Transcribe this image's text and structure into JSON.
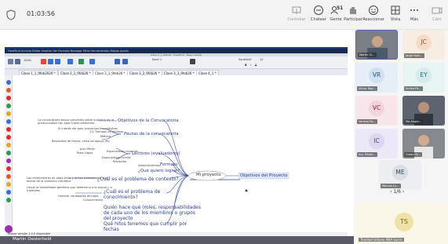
{
  "meeting": {
    "timer": "01:03:56"
  },
  "toolbar": {
    "items": [
      {
        "label": "Controlar",
        "icon": "control-icon"
      },
      {
        "label": "Chatear",
        "icon": "chat-icon"
      },
      {
        "label": "Gente",
        "icon": "people-icon",
        "badge": "51"
      },
      {
        "label": "Participar",
        "icon": "raise-hand-icon"
      },
      {
        "label": "Reaccionar",
        "icon": "react-icon"
      },
      {
        "label": "Vista",
        "icon": "view-icon"
      },
      {
        "label": "Más",
        "icon": "more-icon"
      },
      {
        "label": "Cám",
        "icon": "camera-icon"
      }
    ]
  },
  "shared_app": {
    "title_bar": "Clase 3_1_9feb26 · FreeMind · Mapa mental",
    "menu_text": "FreeMind  Archivo  Editar  Insertar  Ver  Formato  Navegar  Filtro  Herramientas  Mapas  Ayuda",
    "font_name": "SansSerif",
    "font_size": "12",
    "zoom": "100%",
    "node_style": "Nivel 1",
    "tabs": [
      "Clase 1_1_9feb2026 *",
      "Clase 2_1_9feb26 *",
      "Clase 3_1_9feb26 *",
      "Clase 3_2_9feb26 *",
      "Clase 3_3_9feb26 *",
      "Clase 4_1 *"
    ],
    "status": "Nueva versión 1.0.0 disponible"
  },
  "mindmap": {
    "root": "Mi proyecto",
    "right_node": "Objetivos del Proyecto",
    "branches": [
      "Objetivos de la Convocatoria",
      "Pautas de la convocatoria",
      "Lectores (evaluadores)",
      "Formato",
      "¿Qué quiero lograr?",
      "¿Cuál es el problema de contexto?",
      "¿Cuál es el problema de conocimiento?",
      "Quién hace qué (roles, responsabilidades de cada uno de los miembros o grupos del proyecto",
      "Qué hitos tenemos que cumplir por fechas"
    ],
    "small_notes": [
      "La convocatoria busca proyectos sobre sustento de la",
      "productividad con bajo huella ambiental",
      "El interés del país: proyectos tecnológicos",
      "1:1 Tiempos de entrega",
      "Métrica",
      "Requisitos de firmas, carta de apoyo, etc",
      "Juan Pérez",
      "Rosa López",
      "Especialistas expertos",
      "Especialistas comité",
      "Revisores",
      "Administrativos",
      "Los rendimientos de papa en la y la han demostrado que",
      "efecto de la variación climática",
      "Llevar la variabilidad genética que determina a la arquía y a",
      "tuberales",
      "Generar variedades de papa",
      "Conocimiento"
    ]
  },
  "gallery": {
    "participants": [
      {
        "name": "Martin Ci...",
        "initials": "",
        "type": "video"
      },
      {
        "name": "Jorge Nulli...",
        "initials": "JC",
        "bg": "#f6dcc8",
        "fg": "#8a4e2a"
      },
      {
        "name": "Victor Rod...",
        "initials": "VR",
        "bg": "#cfe0f3",
        "fg": "#2a4e7a"
      },
      {
        "name": "Emika Fir...",
        "initials": "EY",
        "bg": "#d5ecec",
        "fg": "#2a6a6a"
      },
      {
        "name": "Vanesa Ro...",
        "initials": "VC",
        "bg": "#f3d4da",
        "fg": "#8a2a3e"
      },
      {
        "name": "Ma.Angel...",
        "initials": "",
        "type": "video"
      },
      {
        "name": "Ing. Elizab...",
        "initials": "IC",
        "bg": "#dcd6f0",
        "fg": "#4a3e8a"
      },
      {
        "name": "Guido Ol...",
        "initials": "",
        "type": "video"
      },
      {
        "name": "Marcos Lu...",
        "initials": "ME",
        "bg": "#d9dde6",
        "fg": "#3a4356"
      }
    ],
    "page": "1/6",
    "featured": {
      "name": "Trinidad Urbano INIA Sucre",
      "initials": "TS"
    }
  },
  "self_view": {
    "name": "Martin Oesterheld"
  },
  "colors": {
    "accent": "#5b5fc7",
    "mind_blue": "#2b3d8f",
    "purple": "#9b2fae"
  }
}
